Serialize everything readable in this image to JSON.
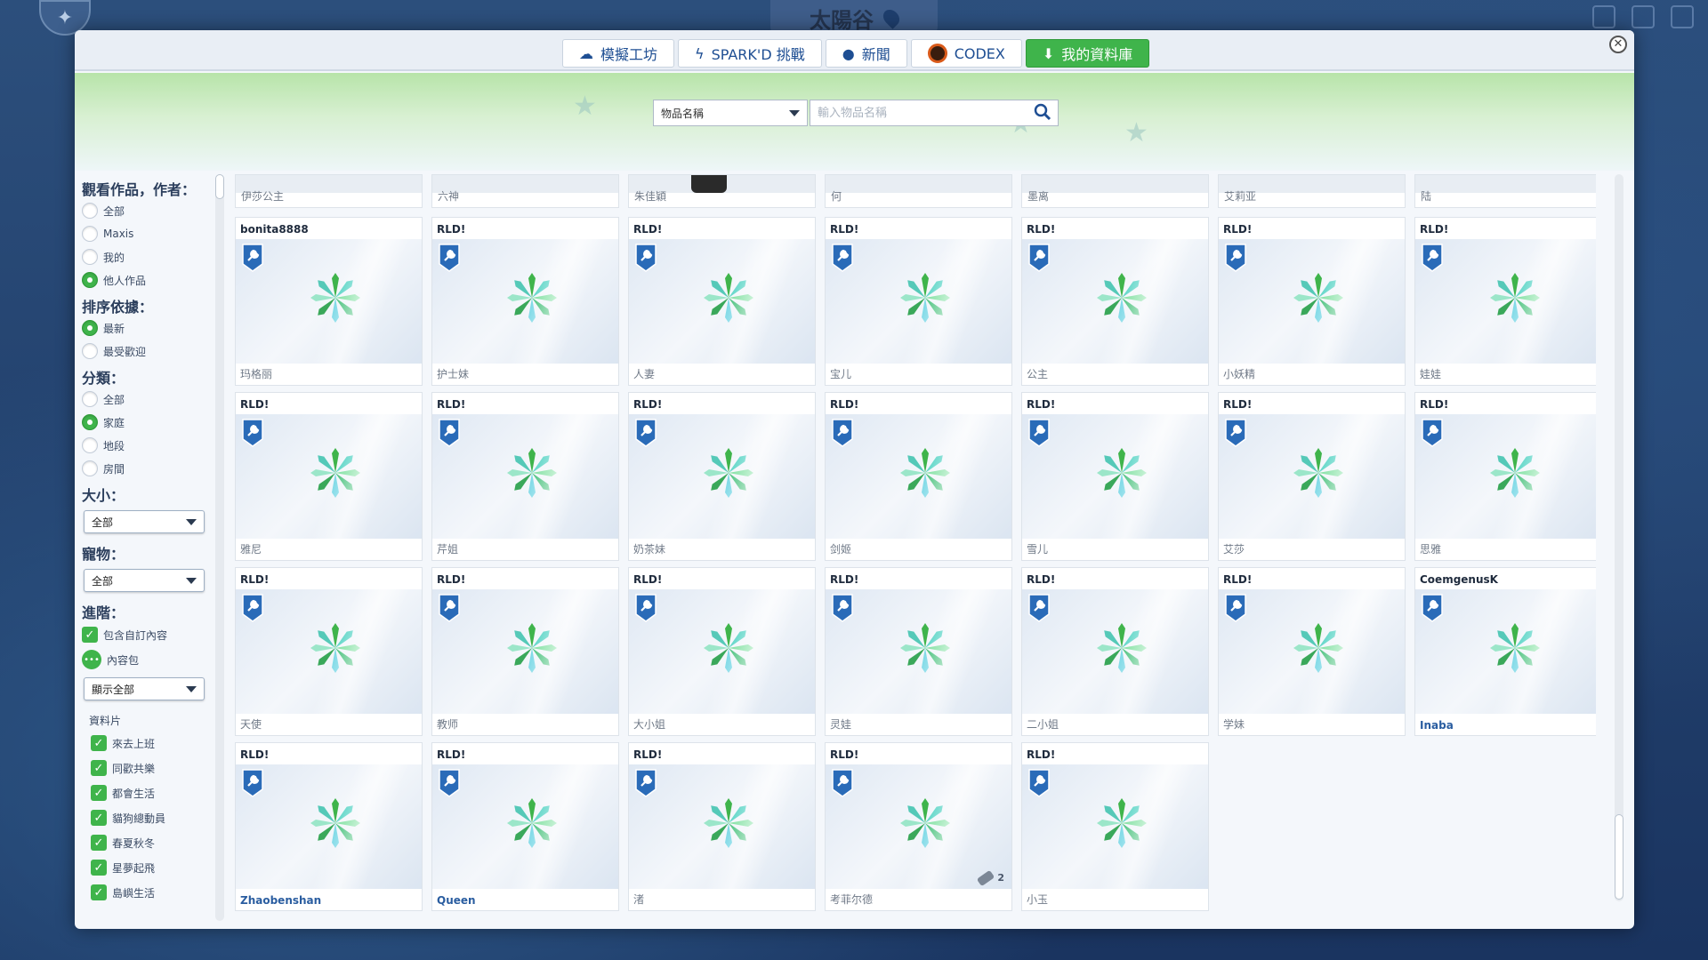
{
  "world": {
    "title": "太陽谷"
  },
  "tabs": [
    {
      "label": "模擬工坊",
      "icon": "cloud-icon"
    },
    {
      "label": "SPARK'D 挑戰",
      "icon": "spark-icon"
    },
    {
      "label": "新聞",
      "icon": "news-icon"
    },
    {
      "label": "CODEX",
      "icon": "codex-icon"
    },
    {
      "label": "我的資料庫",
      "icon": "download-icon",
      "active": true
    }
  ],
  "search": {
    "category": "物品名稱",
    "placeholder": "輸入物品名稱"
  },
  "sidebar": {
    "view_title": "觀看作品，作者：",
    "view_options": [
      "全部",
      "Maxis",
      "我的",
      "他人作品"
    ],
    "view_selected": 3,
    "sort_title": "排序依據：",
    "sort_options": [
      "最新",
      "最受歡迎"
    ],
    "sort_selected": 0,
    "category_title": "分類：",
    "category_options": [
      "全部",
      "家庭",
      "地段",
      "房間"
    ],
    "category_selected": 1,
    "size_title": "大小：",
    "size_value": "全部",
    "pets_title": "寵物：",
    "pets_value": "全部",
    "advanced_title": "進階：",
    "include_custom": "包含自訂內容",
    "content_pack": "內容包",
    "show_all": "顯示全部",
    "expansion_title": "資料片",
    "expansions": [
      "來去上班",
      "同歡共樂",
      "都會生活",
      "貓狗總動員",
      "春夏秋冬",
      "星夢起飛",
      "島嶼生活"
    ]
  },
  "top_row": [
    "伊莎公主",
    "六神",
    "朱佳穎",
    "何",
    "墨离",
    "艾莉亚",
    "陆"
  ],
  "cards": [
    {
      "author": "bonita8888",
      "name": "玛格丽"
    },
    {
      "author": "RLD!",
      "name": "护士妹"
    },
    {
      "author": "RLD!",
      "name": "人妻"
    },
    {
      "author": "RLD!",
      "name": "宝儿"
    },
    {
      "author": "RLD!",
      "name": "公主"
    },
    {
      "author": "RLD!",
      "name": "小妖精"
    },
    {
      "author": "RLD!",
      "name": "娃娃"
    },
    {
      "author": "RLD!",
      "name": "雅尼"
    },
    {
      "author": "RLD!",
      "name": "芹姐"
    },
    {
      "author": "RLD!",
      "name": "奶茶妹"
    },
    {
      "author": "RLD!",
      "name": "剑姬"
    },
    {
      "author": "RLD!",
      "name": "雪儿"
    },
    {
      "author": "RLD!",
      "name": "艾莎"
    },
    {
      "author": "RLD!",
      "name": "思雅"
    },
    {
      "author": "RLD!",
      "name": "天使"
    },
    {
      "author": "RLD!",
      "name": "教师"
    },
    {
      "author": "RLD!",
      "name": "大小姐"
    },
    {
      "author": "RLD!",
      "name": "灵娃"
    },
    {
      "author": "RLD!",
      "name": "二小姐"
    },
    {
      "author": "RLD!",
      "name": "学妹"
    },
    {
      "author": "CoemgenusK",
      "name": "Inaba",
      "bold": true
    },
    {
      "author": "RLD!",
      "name": "Zhaobenshan",
      "bold": true
    },
    {
      "author": "RLD!",
      "name": "Queen",
      "bold": true
    },
    {
      "author": "RLD!",
      "name": "渚"
    },
    {
      "author": "RLD!",
      "name": "考菲尔德",
      "pack_count": "2"
    },
    {
      "author": "RLD!",
      "name": "小玉"
    }
  ],
  "colors": {
    "accent": "#3fb44b",
    "tab_text": "#1e4e93",
    "badge": "#2a6bb8"
  }
}
